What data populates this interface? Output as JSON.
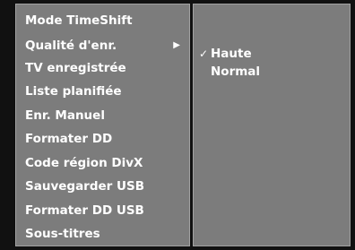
{
  "menu": {
    "items": [
      {
        "label": "Mode TimeShift"
      },
      {
        "label": "Qualité d'enr.",
        "arrow": "▶"
      },
      {
        "label": "TV enregistrée"
      },
      {
        "label": "Liste planifiée"
      },
      {
        "label": "Enr. Manuel"
      },
      {
        "label": "Formater DD"
      },
      {
        "label": "Code région DivX"
      },
      {
        "label": "Sauvegarder USB"
      },
      {
        "label": "Formater DD USB"
      },
      {
        "label": "Sous-titres"
      }
    ]
  },
  "submenu": {
    "items": [
      {
        "label": "Haute",
        "check": "✓"
      },
      {
        "label": "Normal",
        "check": ""
      }
    ]
  }
}
